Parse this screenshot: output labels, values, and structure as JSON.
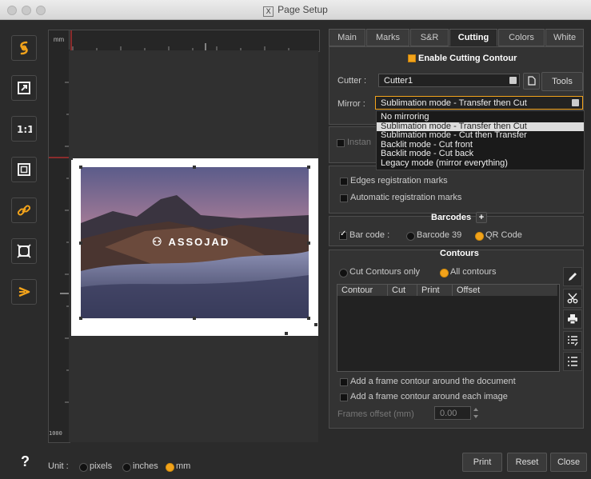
{
  "window": {
    "title": "Page Setup"
  },
  "ruler": {
    "unit": "mm",
    "bottom_value": "1000"
  },
  "image": {
    "logo_text": "ASSOJAD"
  },
  "tabs": [
    {
      "label": "Main"
    },
    {
      "label": "Marks"
    },
    {
      "label": "S&R"
    },
    {
      "label": "Cutting",
      "active": true
    },
    {
      "label": "Colors"
    },
    {
      "label": "White"
    }
  ],
  "cutting": {
    "enable_label": "Enable Cutting Contour",
    "cutter_label": "Cutter :",
    "cutter_value": "Cutter1",
    "tools_label": "Tools",
    "mirror_label": "Mirror :",
    "mirror_value": "Sublimation mode - Transfer then Cut",
    "mirror_options": [
      "No mirroring",
      "Sublimation mode - Transfer then Cut",
      "Sublimation mode - Cut then Transfer",
      "Backlit mode - Cut front",
      "Backlit mode - Cut back",
      "Legacy mode (mirror everything)"
    ],
    "instant_label": "Instan"
  },
  "registration": {
    "edges_label": "Edges registration marks",
    "automatic_label": "Automatic registration marks"
  },
  "barcodes": {
    "title": "Barcodes",
    "add_symbol": "+",
    "bar_code_label": "Bar code :",
    "barcode39_label": "Barcode 39",
    "qr_label": "QR Code"
  },
  "contours": {
    "title": "Contours",
    "cut_only_label": "Cut Contours only",
    "all_label": "All contours",
    "columns": [
      "Contour",
      "Cut",
      "Print",
      "Offset"
    ],
    "frame_document_label": "Add a frame contour around the document",
    "frame_image_label": "Add a frame contour around each image",
    "frames_offset_label": "Frames offset (mm)",
    "frames_offset_value": "0.00"
  },
  "units": {
    "help": "?",
    "label": "Unit :",
    "pixels": "pixels",
    "inches": "inches",
    "mm": "mm"
  },
  "footer": {
    "print": "Print",
    "reset": "Reset",
    "close": "Close"
  },
  "colors": {
    "accent": "#f2a31b",
    "background": "#2b2b2b"
  }
}
